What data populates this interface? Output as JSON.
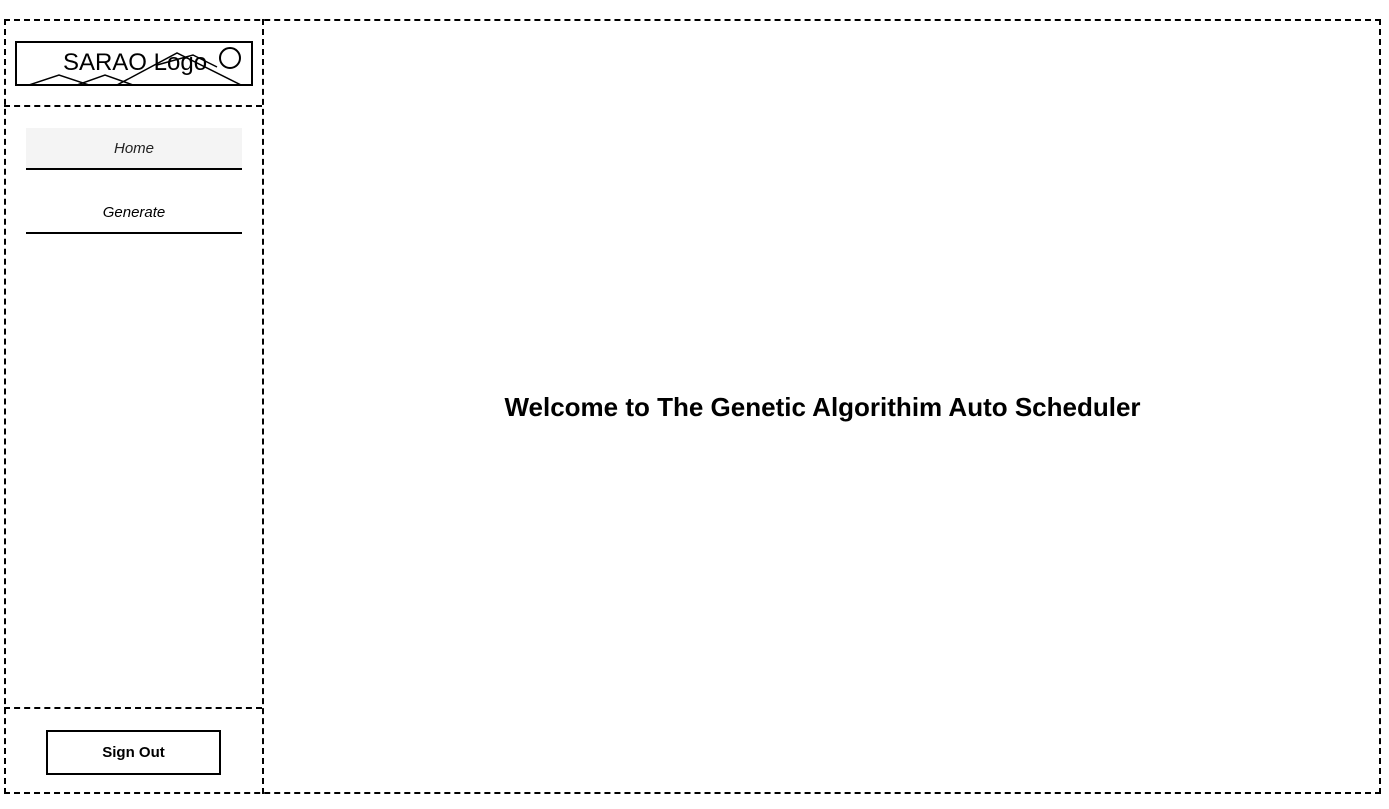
{
  "sidebar": {
    "logo": {
      "text": "SARAO Logo",
      "icon": "mountain-sun-logo-icon"
    },
    "nav": [
      {
        "label": "Home",
        "active": true
      },
      {
        "label": "Generate",
        "active": false
      }
    ],
    "sign_out_label": "Sign Out"
  },
  "main": {
    "welcome_text": "Welcome to The Genetic Algorithim Auto Scheduler"
  }
}
